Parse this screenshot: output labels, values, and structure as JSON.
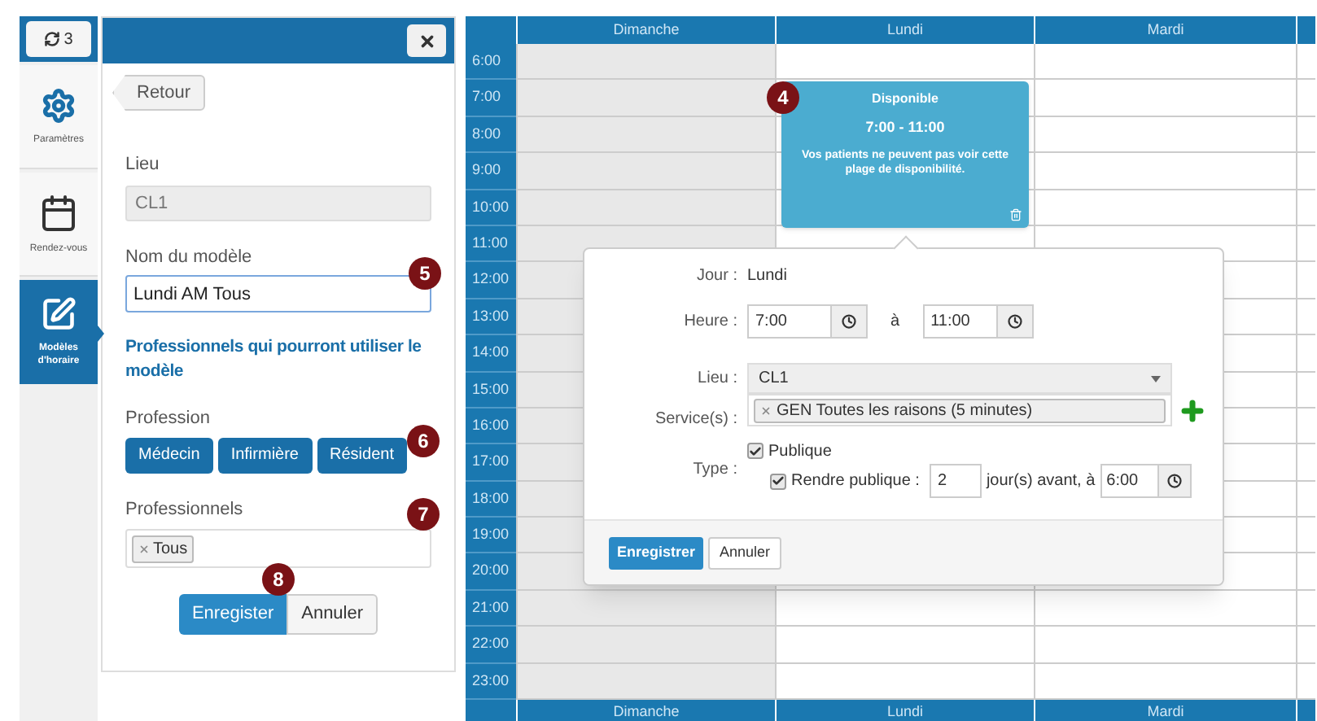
{
  "nav": {
    "sync_count": "3",
    "items": [
      {
        "kind": "gear",
        "label": "Paramètres",
        "selected": false
      },
      {
        "kind": "calendar",
        "label": "Rendez-vous",
        "selected": false
      },
      {
        "kind": "edit",
        "label": "Modèles d'horaire",
        "selected": true
      }
    ]
  },
  "panel": {
    "back_button": "Retour",
    "location": {
      "label": "Lieu",
      "value": "CL1",
      "disabled": true
    },
    "template_name": {
      "label": "Nom du modèle",
      "value": "Lundi AM Tous",
      "badge": "5"
    },
    "section_title": "Professionnels qui pourront utiliser le modèle",
    "profession": {
      "label": "Profession",
      "options": [
        "Médecin",
        "Infirmière",
        "Résident"
      ],
      "badge": "6"
    },
    "professionals": {
      "label": "Professionnels",
      "tags": [
        "Tous"
      ],
      "badge": "7"
    },
    "save_button": "Enregister",
    "save_badge": "8",
    "cancel_button": "Annuler"
  },
  "calendar": {
    "days": [
      {
        "name": "Dimanche",
        "shaded": true
      },
      {
        "name": "Lundi",
        "shaded": false
      },
      {
        "name": "Mardi",
        "shaded": false
      }
    ],
    "hours": [
      "6:00",
      "7:00",
      "8:00",
      "9:00",
      "10:00",
      "11:00",
      "12:00",
      "13:00",
      "14:00",
      "15:00",
      "16:00",
      "17:00",
      "18:00",
      "19:00",
      "20:00",
      "21:00",
      "22:00",
      "23:00"
    ],
    "footer_days": [
      "Dimanche",
      "Lundi",
      "Mardi"
    ],
    "event": {
      "title": "Disponible",
      "time": "7:00 - 11:00",
      "note": "Vos patients ne peuvent pas voir cette plage de disponibilité.",
      "badge": "4"
    }
  },
  "form": {
    "day_label": "Jour :",
    "day_value": "Lundi",
    "time_label": "Heure :",
    "start": "7:00",
    "separator": "à",
    "end": "11:00",
    "location_label": "Lieu :",
    "location_value": "CL1",
    "services_label": "Service(s) :",
    "services": [
      "GEN Toutes les raisons (5 minutes)"
    ],
    "type_label": "Type :",
    "public": {
      "label": "Publique",
      "checked": true
    },
    "make_public": {
      "label": "Rendre publique :",
      "checked": true,
      "days": "2",
      "suffix": "jour(s) avant, à",
      "time": "6:00"
    },
    "save_button": "Enregistrer",
    "cancel_button": "Annuler"
  }
}
